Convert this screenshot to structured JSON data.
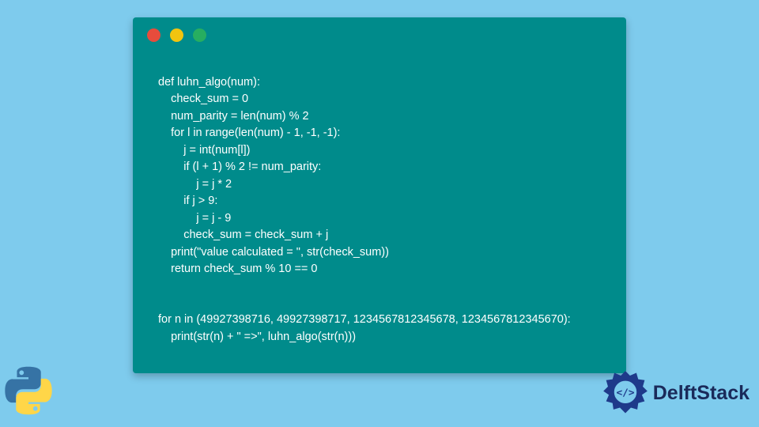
{
  "code": {
    "lines": [
      "def luhn_algo(num):",
      "    check_sum = 0",
      "    num_parity = len(num) % 2",
      "    for l in range(len(num) - 1, -1, -1):",
      "        j = int(num[l])",
      "        if (l + 1) % 2 != num_parity:",
      "            j = j * 2",
      "        if j > 9:",
      "            j = j - 9",
      "        check_sum = check_sum + j",
      "    print(\"value calculated = \", str(check_sum))",
      "    return check_sum % 10 == 0",
      "",
      "",
      "for n in (49927398716, 49927398717, 1234567812345678, 1234567812345670):",
      "    print(str(n) + \" =>\", luhn_algo(str(n)))"
    ]
  },
  "branding": {
    "name": "DelftStack"
  },
  "window": {
    "dot_colors": {
      "red": "#e74c3c",
      "yellow": "#f1c40f",
      "green": "#27ae60"
    }
  }
}
